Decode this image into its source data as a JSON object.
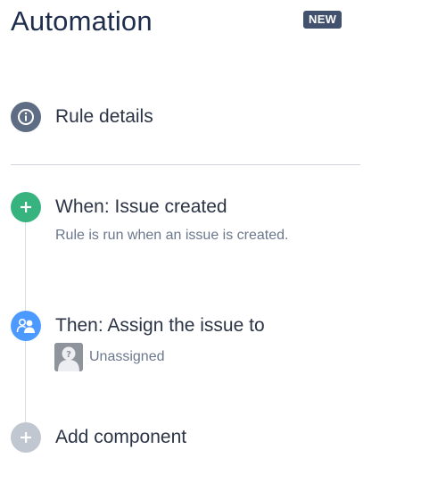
{
  "header": {
    "title": "Automation",
    "badge": "NEW"
  },
  "rule_details": {
    "label": "Rule details",
    "icon": "info-icon"
  },
  "trigger": {
    "title": "When: Issue created",
    "description": "Rule is run when an issue is created.",
    "icon": "plus-icon",
    "color": "#36b37e"
  },
  "action": {
    "title": "Then: Assign the issue to",
    "assignee": "Unassigned",
    "icon": "assign-user-icon",
    "color": "#4c9aff"
  },
  "add_component": {
    "label": "Add component",
    "icon": "plus-icon",
    "color": "#c1c7d0"
  }
}
